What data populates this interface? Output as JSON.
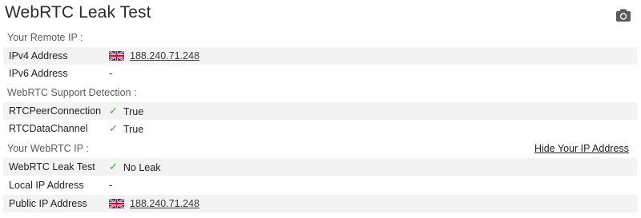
{
  "page": {
    "title": "WebRTC Leak Test",
    "screenshot_icon": "camera-icon"
  },
  "remote_ip": {
    "heading": "Your Remote IP :",
    "ipv4_label": "IPv4 Address",
    "ipv4_value": "188.240.71.248",
    "ipv4_flag": "uk-flag-icon",
    "ipv6_label": "IPv6 Address",
    "ipv6_value": "-"
  },
  "webrtc_support": {
    "heading": "WebRTC Support Detection :",
    "peer_label": "RTCPeerConnection",
    "peer_value": "True",
    "channel_label": "RTCDataChannel",
    "channel_value": "True",
    "check_icon": "check-icon"
  },
  "webrtc_ip": {
    "heading": "Your WebRTC IP :",
    "hide_link": "Hide Your IP Address",
    "leak_label": "WebRTC Leak Test",
    "leak_value": "No Leak",
    "local_label": "Local IP Address",
    "local_value": "-",
    "public_label": "Public IP Address",
    "public_value": "188.240.71.248",
    "public_flag": "uk-flag-icon"
  },
  "colors": {
    "row_shade": "#f3f3f3",
    "check": "#3fa63f",
    "text": "#222222",
    "heading": "#5b5b5b"
  }
}
